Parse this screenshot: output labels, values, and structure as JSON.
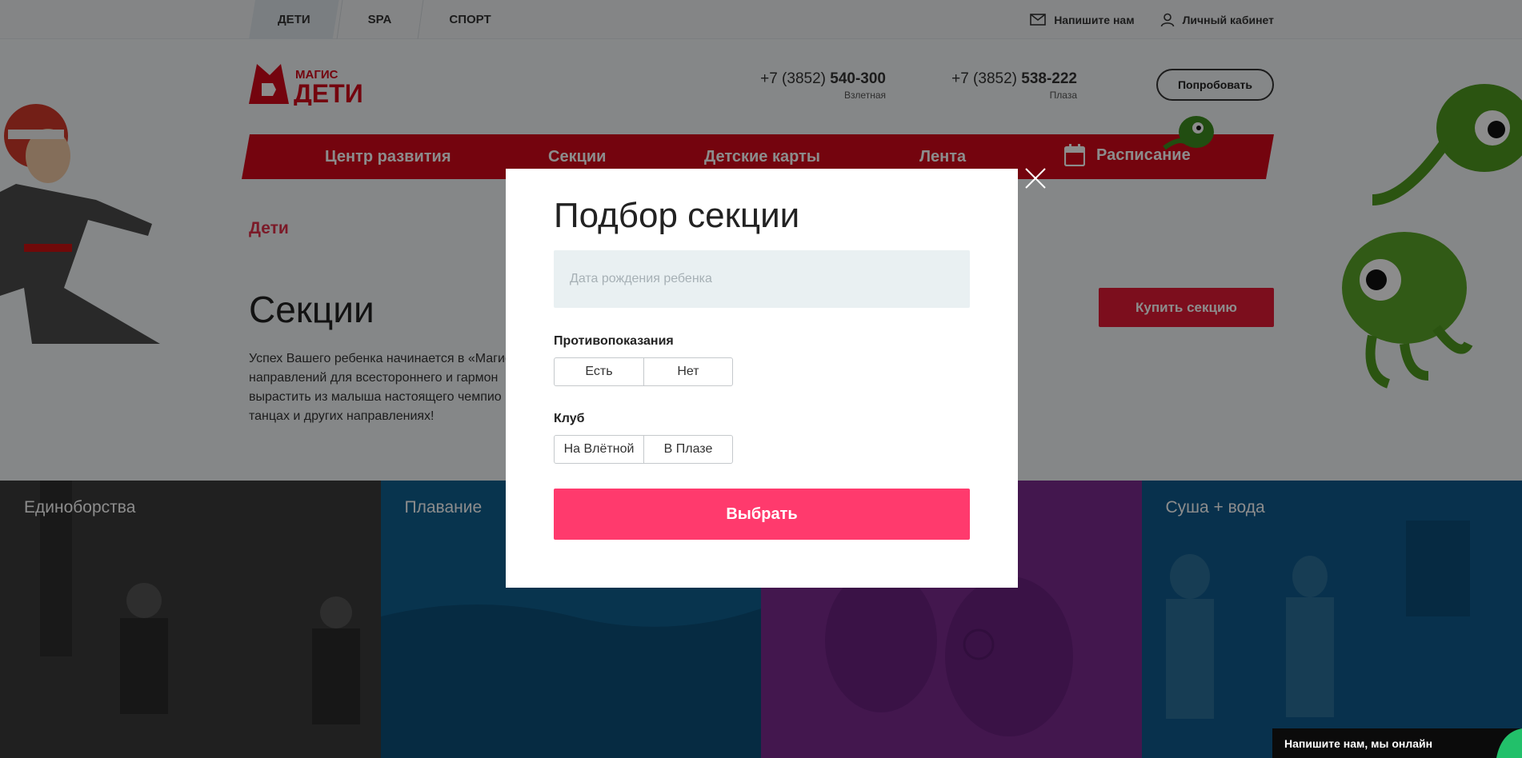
{
  "topbar": {
    "tabs": [
      {
        "label": "ДЕТИ",
        "active": true
      },
      {
        "label": "SPA",
        "active": false
      },
      {
        "label": "СПОРТ",
        "active": false
      }
    ],
    "write_us": "Напишите нам",
    "account": "Личный кабинет"
  },
  "header": {
    "logo": {
      "top_text": "МАГИС",
      "main_text": "ДЕТИ"
    },
    "phones": [
      {
        "prefix": "+7 (3852)",
        "number": "540-300",
        "location": "Взлетная"
      },
      {
        "prefix": "+7 (3852)",
        "number": "538-222",
        "location": "Плаза"
      }
    ],
    "try_button": "Попробовать"
  },
  "nav": {
    "items": [
      "Центр развития",
      "Секции",
      "Детские карты",
      "Лента",
      "Расписание"
    ]
  },
  "page": {
    "breadcrumb": "Дети",
    "title": "Секции",
    "intro": "Успех Вашего ребенка начинается в «Магис направлений для всестороннего и гармон вырастить из малыша настоящего чемпио танцах и других направлениях!",
    "buy_button": "Купить секцию"
  },
  "tiles": [
    {
      "label": "Единоборства",
      "color": "#3a3a3a"
    },
    {
      "label": "Плавание",
      "color": "#0f5f8f"
    },
    {
      "label": "",
      "color": "#7a2a8e"
    },
    {
      "label": "Суша + вода",
      "color": "#0f5a8c"
    }
  ],
  "modal": {
    "title": "Подбор секции",
    "birthdate_placeholder": "Дата рождения ребенка",
    "contraindications_label": "Противопоказания",
    "contraindications_options": [
      "Есть",
      "Нет"
    ],
    "club_label": "Клуб",
    "club_options": [
      "На Влётной",
      "В Плазе"
    ],
    "submit": "Выбрать"
  },
  "chat": {
    "label": "Напишите нам, мы онлайн"
  },
  "colors": {
    "brand_red": "#d3091a",
    "accent_pink": "#ff3a6d",
    "breadcrumb": "#e0304a"
  }
}
